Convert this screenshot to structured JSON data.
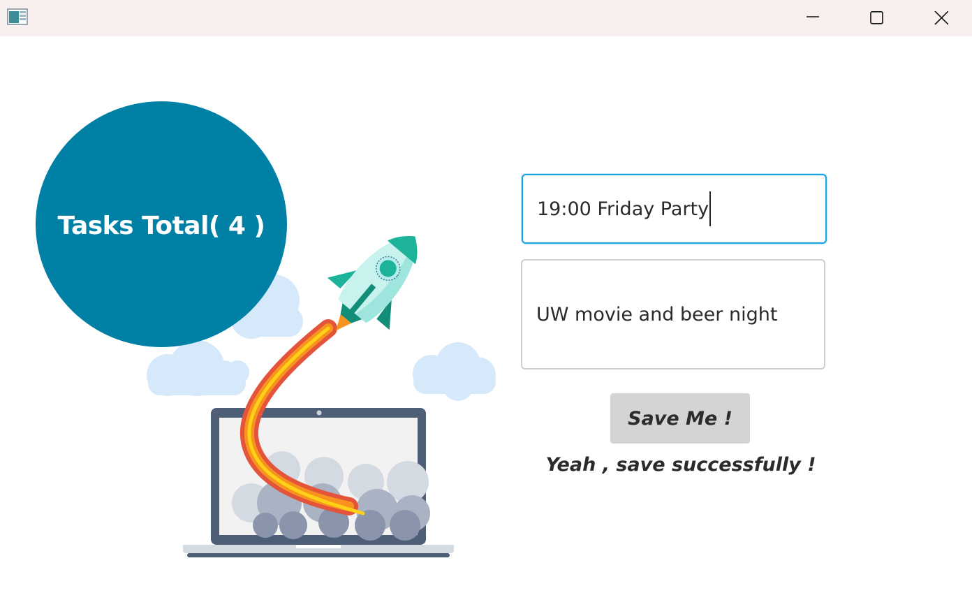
{
  "window": {
    "title": "",
    "controls": [
      "minimize-icon",
      "maximize-icon",
      "close-icon"
    ]
  },
  "summary": {
    "total_label": "Tasks Total( 4 )",
    "circle_color": "#0180a6"
  },
  "form": {
    "title_value": "19:00 Friday Party",
    "description_value": "UW movie and beer night",
    "save_label": "Save Me !",
    "status_message": "Yeah , save successfully !"
  },
  "illustration": {
    "name": "rocket-launch-from-laptop",
    "icon": "rocket-icon"
  },
  "colors": {
    "focus_border": "#1aa3e0",
    "button_bg": "#d4d4d4",
    "titlebar_bg": "#f7f0ee"
  }
}
